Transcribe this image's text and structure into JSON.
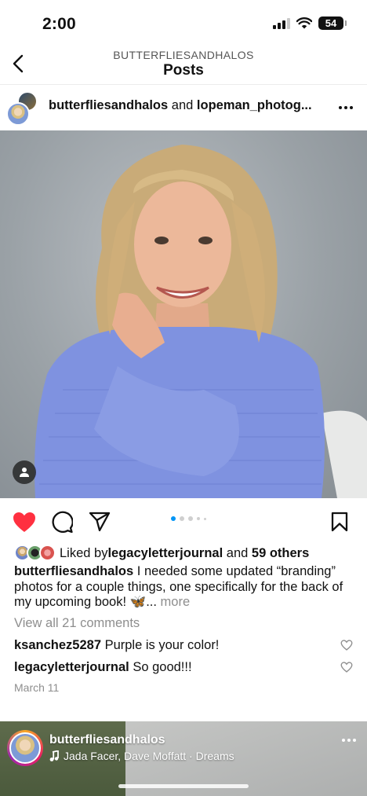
{
  "status_bar": {
    "time": "2:00",
    "battery": "54"
  },
  "nav": {
    "username": "BUTTERFLIESANDHALOS",
    "title": "Posts"
  },
  "post": {
    "author": "butterfliesandhalos",
    "and_text": " and ",
    "collaborator": "lopeman_photog...",
    "image_dots": {
      "count": 5,
      "active": 1
    },
    "likes": {
      "prefix": "Liked by ",
      "user": "legacyletterjournal",
      "mid": " and ",
      "others": "59 others"
    },
    "caption": {
      "user": "butterfliesandhalos",
      "text": " I needed some updated “branding” photos for a couple things, one specifically for the back of my upcoming book! 🦋",
      "ellipsis": "... ",
      "more": "more"
    },
    "view_comments": "View all 21 comments",
    "comments": [
      {
        "user": "ksanchez5287",
        "text": " Purple is your color!"
      },
      {
        "user": "legacyletterjournal",
        "text": " So good!!!"
      }
    ],
    "date": "March 11"
  },
  "next_post": {
    "author": "butterfliesandhalos",
    "music": "Jada Facer, Dave Moffatt · Dreams"
  },
  "colors": {
    "like_red": "#ff3040",
    "accent_blue": "#0095f6",
    "muted": "#8e8e8e"
  },
  "icons": [
    "back-chevron-icon",
    "more-options-icon",
    "user-tag-icon",
    "heart-filled-icon",
    "comment-icon",
    "share-icon",
    "bookmark-icon",
    "comment-heart-icon",
    "music-note-icon",
    "signal-icon",
    "wifi-icon",
    "battery-icon"
  ]
}
